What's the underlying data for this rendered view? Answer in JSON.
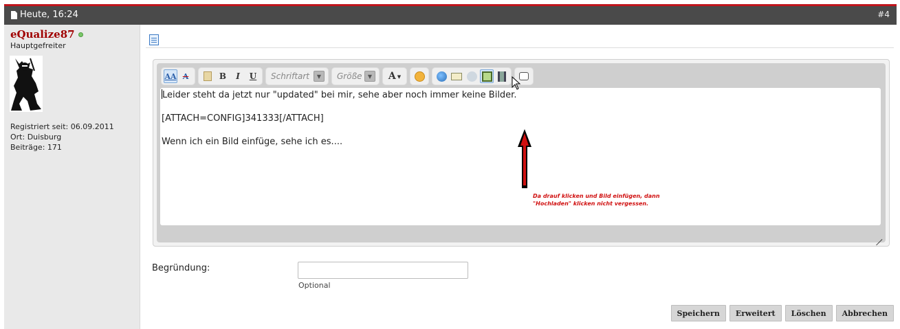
{
  "post": {
    "date": "Heute, 16:24",
    "number": "#4"
  },
  "user": {
    "name": "eQualize87",
    "status": "online",
    "rank": "Hauptgefreiter",
    "registered": "Registriert seit: 06.09.2011",
    "location": "Ort: Duisburg",
    "posts": "Beiträge: 171"
  },
  "toolbar": {
    "font_placeholder": "Schriftart",
    "size_placeholder": "Größe",
    "bold": "B",
    "italic": "I",
    "underline": "U",
    "textcolor": "A"
  },
  "editor": {
    "lines": [
      "Leider steht da jetzt nur \"updated\" bei mir, sehe aber noch immer keine Bilder.",
      "[ATTACH=CONFIG]341333[/ATTACH]",
      "Wenn ich ein Bild einfüge, sehe ich es...."
    ]
  },
  "annotation": {
    "line1": "Da drauf klicken und Bild einfügen, dann",
    "line2": "\"Hochladen\" klicken nicht vergessen.",
    "color": "#d01010"
  },
  "reason": {
    "label": "Begründung:",
    "value": "",
    "hint": "Optional"
  },
  "actions": {
    "save": "Speichern",
    "advanced": "Erweitert",
    "delete": "Löschen",
    "cancel": "Abbrechen"
  },
  "colors": {
    "header_bg": "#4a4a4a",
    "accent_red": "#c0141c",
    "username": "#a00000"
  }
}
